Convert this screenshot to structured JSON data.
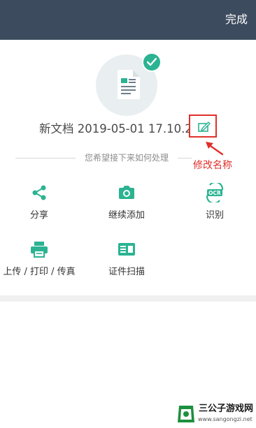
{
  "header": {
    "done_label": "完成"
  },
  "document": {
    "filename": "新文档 2019-05-01 17.10.21"
  },
  "prompt": "您希望接下来如何处理",
  "annotation": "修改名称",
  "actions": [
    {
      "label": "分享",
      "icon": "share-icon"
    },
    {
      "label": "继续添加",
      "icon": "camera-icon"
    },
    {
      "label": "识别",
      "icon": "ocr-icon"
    },
    {
      "label": "上传 / 打印 / 传真",
      "icon": "printer-icon"
    },
    {
      "label": "证件扫描",
      "icon": "id-card-icon"
    }
  ],
  "watermark": {
    "name": "三公子游戏网",
    "url": "www.sangongzi.net"
  },
  "colors": {
    "header": "#3c4b5e",
    "accent": "#2bb392",
    "annotation": "#e0302a"
  }
}
